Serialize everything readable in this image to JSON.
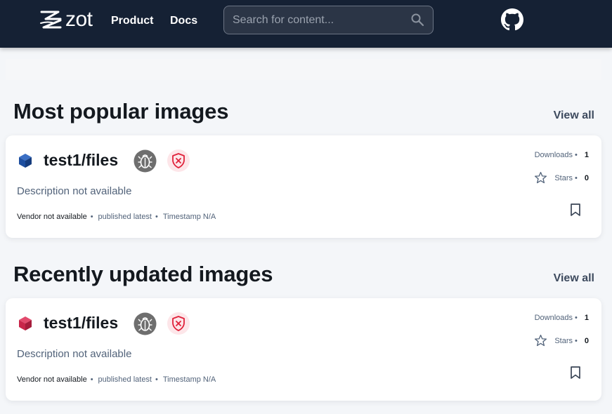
{
  "header": {
    "logo_text": "zot",
    "nav": {
      "product": "Product",
      "docs": "Docs"
    },
    "search": {
      "placeholder": "Search for content..."
    }
  },
  "sections": [
    {
      "title": "Most popular images",
      "view_all": "View all",
      "card": {
        "name": "test1/files",
        "icon_color": "#1e4fa0",
        "description": "Description not available",
        "vendor": "Vendor not available",
        "published": "published latest",
        "timestamp": "Timestamp N/A",
        "downloads_label": "Downloads",
        "downloads": "1",
        "stars_label": "Stars",
        "stars": "0"
      }
    },
    {
      "title": "Recently updated images",
      "view_all": "View all",
      "card": {
        "name": "test1/files",
        "icon_color": "#c8264a",
        "description": "Description not available",
        "vendor": "Vendor not available",
        "published": "published latest",
        "timestamp": "Timestamp N/A",
        "downloads_label": "Downloads",
        "downloads": "1",
        "stars_label": "Stars",
        "stars": "0"
      }
    }
  ],
  "icons": [
    "zot-logo-icon",
    "search-icon",
    "github-icon",
    "package-icon",
    "bug-icon",
    "shield-x-icon",
    "star-icon",
    "bookmark-icon"
  ],
  "colors": {
    "header_bg": "#152134",
    "page_bg": "#f4f6f9",
    "shield": "#e0213a",
    "bug_bg": "#6e6e6e"
  }
}
